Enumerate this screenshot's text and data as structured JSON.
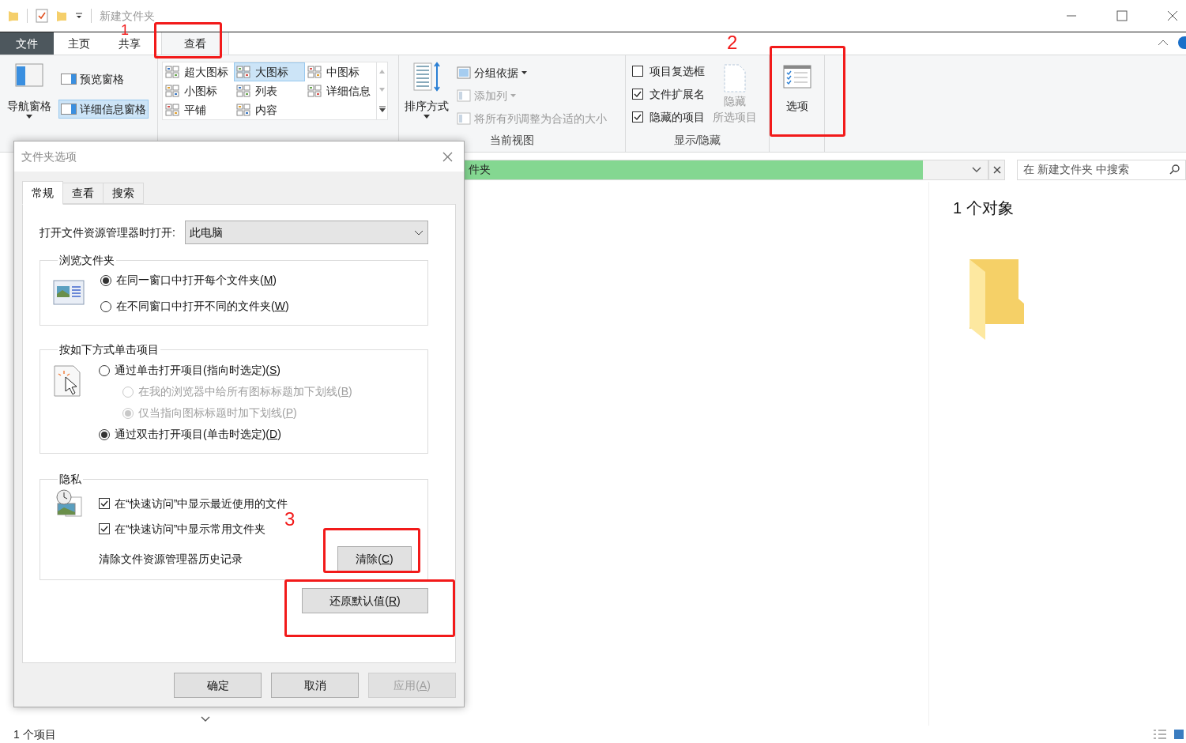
{
  "window": {
    "title": "新建文件夹"
  },
  "ribbon_tabs": [
    {
      "label": "文件",
      "kind": "file",
      "selected": false
    },
    {
      "label": "主页",
      "kind": "tab",
      "selected": false
    },
    {
      "label": "共享",
      "kind": "tab",
      "selected": false
    },
    {
      "label": "查看",
      "kind": "tab",
      "selected": true
    }
  ],
  "ribbon": {
    "panes": {
      "navigation_pane": "导航窗格",
      "items": [
        {
          "label": "预览窗格",
          "selected": false
        },
        {
          "label": "详细信息窗格",
          "selected": true
        }
      ]
    },
    "layout": [
      {
        "label": "超大图标",
        "selected": false
      },
      {
        "label": "大图标",
        "selected": true
      },
      {
        "label": "中图标",
        "selected": false
      },
      {
        "label": "小图标",
        "selected": false
      },
      {
        "label": "列表",
        "selected": false
      },
      {
        "label": "详细信息",
        "selected": false
      },
      {
        "label": "平铺",
        "selected": false
      },
      {
        "label": "内容",
        "selected": false
      }
    ],
    "current_view": {
      "sort_by": "排序方式",
      "items": [
        {
          "label": "分组依据",
          "disabled": false,
          "has_menu": true
        },
        {
          "label": "添加列",
          "disabled": true,
          "has_menu": true
        },
        {
          "label": "将所有列调整为合适的大小",
          "disabled": true,
          "has_menu": false
        }
      ],
      "group_label": "当前视图"
    },
    "show_hide": {
      "checkboxes": [
        {
          "label": "项目复选框",
          "checked": false
        },
        {
          "label": "文件扩展名",
          "checked": true
        },
        {
          "label": "隐藏的项目",
          "checked": true
        }
      ],
      "hide_selected": {
        "lines": [
          "隐藏",
          "所选项目"
        ],
        "disabled": true
      },
      "group_label": "显示/隐藏"
    },
    "options": {
      "label": "选项"
    }
  },
  "address_bar": {
    "text": "件夹",
    "level": 0.93
  },
  "search": {
    "placeholder": "在 新建文件夹 中搜索"
  },
  "details_pane": {
    "title": "1 个对象"
  },
  "status_bar": {
    "text": "1 个项目"
  },
  "dialog": {
    "title": "文件夹选项",
    "tabs": [
      {
        "label": "常规",
        "selected": true
      },
      {
        "label": "查看",
        "selected": false
      },
      {
        "label": "搜索",
        "selected": false
      }
    ],
    "open_with": {
      "label": "打开文件资源管理器时打开:",
      "value": "此电脑"
    },
    "browse": {
      "legend": "浏览文件夹",
      "options": [
        {
          "text": "在同一窗口中打开每个文件夹(",
          "access_key": "M",
          "text_end": ")",
          "selected": true
        },
        {
          "text": "在不同窗口中打开不同的文件夹(",
          "access_key": "W",
          "text_end": ")",
          "selected": false
        }
      ]
    },
    "click": {
      "legend": "按如下方式单击项目",
      "options": [
        {
          "text": "通过单击打开项目(指向时选定)(",
          "access_key": "S",
          "text_end": ")",
          "selected": false,
          "disabled": false,
          "children": [
            {
              "text": "在我的浏览器中给所有图标标题加下划线(",
              "access_key": "B",
              "text_end": ")",
              "selected": false,
              "disabled": true
            },
            {
              "text": "仅当指向图标标题时加下划线(",
              "access_key": "P",
              "text_end": ")",
              "selected": true,
              "disabled": true
            }
          ]
        },
        {
          "text": "通过双击打开项目(单击时选定)(",
          "access_key": "D",
          "text_end": ")",
          "selected": true,
          "disabled": false
        }
      ]
    },
    "privacy": {
      "legend": "隐私",
      "checkboxes": [
        {
          "label": "在“快速访问”中显示最近使用的文件",
          "checked": true
        },
        {
          "label": "在“快速访问”中显示常用文件夹",
          "checked": true
        }
      ],
      "clear_label": "清除文件资源管理器历史记录",
      "clear_button": {
        "text": "清除(",
        "access_key": "C",
        "text_end": ")"
      }
    },
    "restore_button": {
      "text": "还原默认值(",
      "access_key": "R",
      "text_end": ")"
    },
    "footer_buttons": [
      {
        "text": "确定",
        "disabled": false
      },
      {
        "text": "取消",
        "disabled": false
      },
      {
        "text": "应用(",
        "access_key": "A",
        "text_end": ")",
        "disabled": true
      }
    ]
  },
  "annotations": [
    "1",
    "2",
    "3"
  ]
}
